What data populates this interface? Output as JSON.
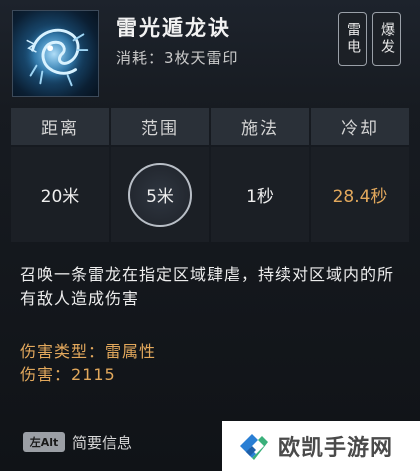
{
  "skill": {
    "icon": "thunder-dragon-skill-icon",
    "name": "雷光遁龙诀",
    "cost": "消耗：3枚天雷印",
    "tags": [
      "雷电",
      "爆发"
    ]
  },
  "stats": {
    "headers": [
      "距离",
      "范围",
      "施法",
      "冷却"
    ],
    "values": [
      "20米",
      "5米",
      "1秒",
      "28.4秒"
    ]
  },
  "description": "召唤一条雷龙在指定区域肆虐，持续对区域内的所有敌人造成伤害",
  "attributes": {
    "damage_type_label": "伤害类型：",
    "damage_type_value": "雷属性",
    "damage_label": "伤害：",
    "damage_value": "2115"
  },
  "footer": {
    "key_label": "左Alt",
    "brief_label": "简要信息"
  },
  "watermark": {
    "icon": "ouka-logo-icon",
    "text": "欧凯手游网"
  },
  "colors": {
    "accent_gold": "#e2a85c",
    "background": "#171b21",
    "header_cell": "#2a3038"
  }
}
